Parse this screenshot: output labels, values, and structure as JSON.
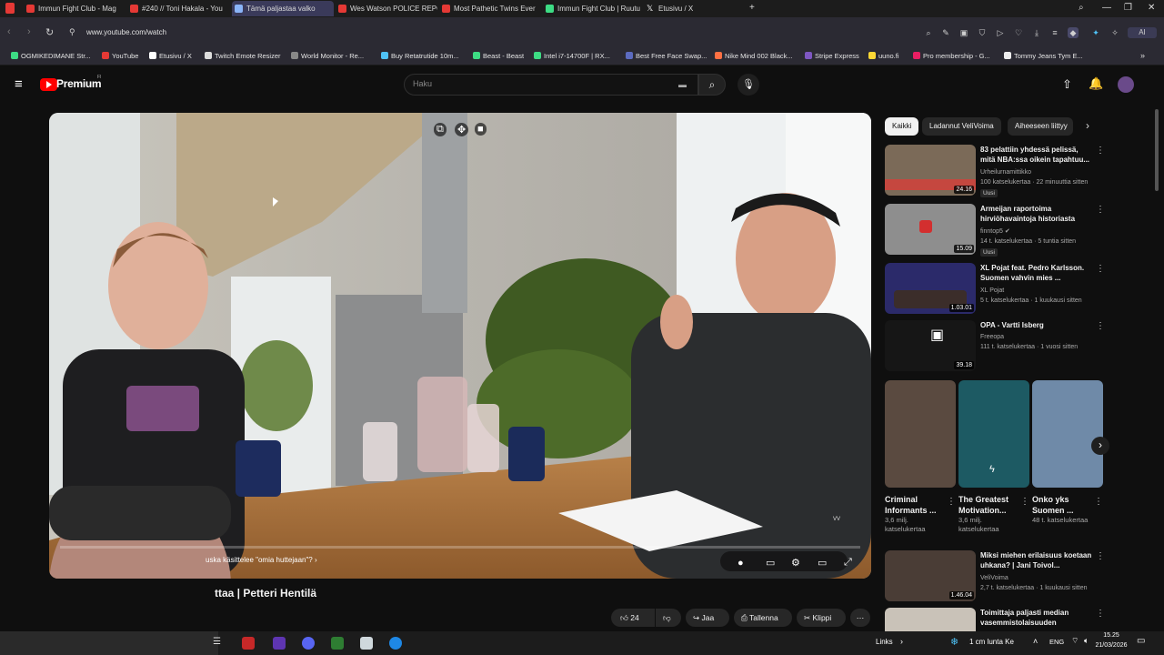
{
  "browser": {
    "tabs": [
      {
        "label": "Immun Fight Club - Mag",
        "color": "#e53935"
      },
      {
        "label": "#240 // Toni Hakala - You",
        "color": "#e53935"
      },
      {
        "label": "Tämä paljastaa valko",
        "color": "#8ab4f8",
        "active": true
      },
      {
        "label": "Wes Watson POLICE REPC",
        "color": "#e53935"
      },
      {
        "label": "Most Pathetic Twins Ever",
        "color": "#e53935"
      },
      {
        "label": "Immun Fight Club | Ruutu",
        "color": "#3ddc84"
      },
      {
        "label": "Etusivu / X",
        "color": "#ffffff"
      }
    ],
    "url": "www.youtube.com/watch",
    "bookmarks": [
      {
        "label": "OGMIKEDIMANE Str...",
        "color": "#3ddc84"
      },
      {
        "label": "YouTube",
        "color": "#e53935"
      },
      {
        "label": "Etusivu / X",
        "color": "#ffffff"
      },
      {
        "label": "Twitch Emote Resizer",
        "color": "#dddddd"
      },
      {
        "label": "World Monitor - Re...",
        "color": "#888888"
      },
      {
        "label": "Buy Retatrutide 10m...",
        "color": "#4fc3f7"
      },
      {
        "label": "Beast - Beast",
        "color": "#3ddc84"
      },
      {
        "label": "Intel i7-14700F | RX...",
        "color": "#3ddc84"
      },
      {
        "label": "Best Free Face Swap...",
        "color": "#5c6bc0"
      },
      {
        "label": "Nike Mind 002 Black...",
        "color": "#ff7043"
      },
      {
        "label": "Stripe Express",
        "color": "#7e57c2"
      },
      {
        "label": "uuno.fi",
        "color": "#fdd835"
      },
      {
        "label": "Pro membership - G...",
        "color": "#e91e63"
      },
      {
        "label": "Tommy Jeans Tym E...",
        "color": "#eeeeee"
      }
    ]
  },
  "youtube": {
    "logo": "Premium",
    "logo_sup": "FI",
    "search_placeholder": "Haku",
    "video": {
      "chapter": "uska käsittelee \"omia huttejaan\"?",
      "title_visible": "ttaa | Petteri Hentilä",
      "likes": "24",
      "share": "Jaa",
      "save": "Tallenna",
      "clip": "Klippi"
    },
    "chips": [
      "Kaikki",
      "Ladannut VeliVoima",
      "Aiheeseen liittyy"
    ],
    "recommended": [
      {
        "title": "83 pelattiin yhdessä pelissä, mitä NBA:ssa oikein tapahtuu...",
        "channel": "Urheilurnamittikko",
        "meta": "100 katselukertaa · 22 minuuttia sitten",
        "badge": "Uusi",
        "duration": "24.16",
        "thumb": "#7b6a58"
      },
      {
        "title": "Armeijan raportoima hirviöhavaintoja historiasta",
        "channel": "finntop5",
        "meta": "14 t. katselukertaa · 5 tuntia sitten",
        "badge": "Uusi",
        "duration": "15.09",
        "thumb": "#8e8e8e"
      },
      {
        "title": "XL Pojat feat. Pedro Karlsson. Suomen vahvin mies ...",
        "channel": "XL Pojat",
        "meta": "5 t. katselukertaa · 1 kuukausi sitten",
        "badge": "",
        "duration": "1.03.01",
        "thumb": "#2b2a6a"
      },
      {
        "title": "OPA - Vartti Isberg",
        "channel": "Freeopa",
        "meta": "111 t. katselukertaa · 1 vuosi sitten",
        "badge": "",
        "duration": "39.18",
        "thumb": "#161616"
      }
    ],
    "shorts": [
      {
        "title": "Criminal Informants ...",
        "meta": "3,6 milj. katselukertaa",
        "thumb": "#5a4a40"
      },
      {
        "title": "The Greatest Motivation...",
        "meta": "3,6 milj. katselukertaa",
        "thumb": "#1d5a63"
      },
      {
        "title": "Onko yks Suomen ...",
        "meta": "48 t. katselukertaa",
        "thumb": "#6f8aa8"
      }
    ],
    "more_recommended": [
      {
        "title": "Miksi miehen erilaisuus koetaan uhkana? | Jani Toivol...",
        "channel": "VeliVoima",
        "meta": "2,7 t. katselukertaa · 1 kuukausi sitten",
        "duration": "1.46.04",
        "thumb": "#4a3d36"
      },
      {
        "title": "Toimittaja paljasti median vasemmistolaisuuden",
        "channel": "",
        "meta": "",
        "duration": "",
        "thumb": "#c9c2b8"
      }
    ]
  },
  "taskbar": {
    "links": "Links",
    "weather": "1 cm lunta Ke",
    "lang": "ENG",
    "time": "15.25",
    "date": "21/03/2026"
  }
}
